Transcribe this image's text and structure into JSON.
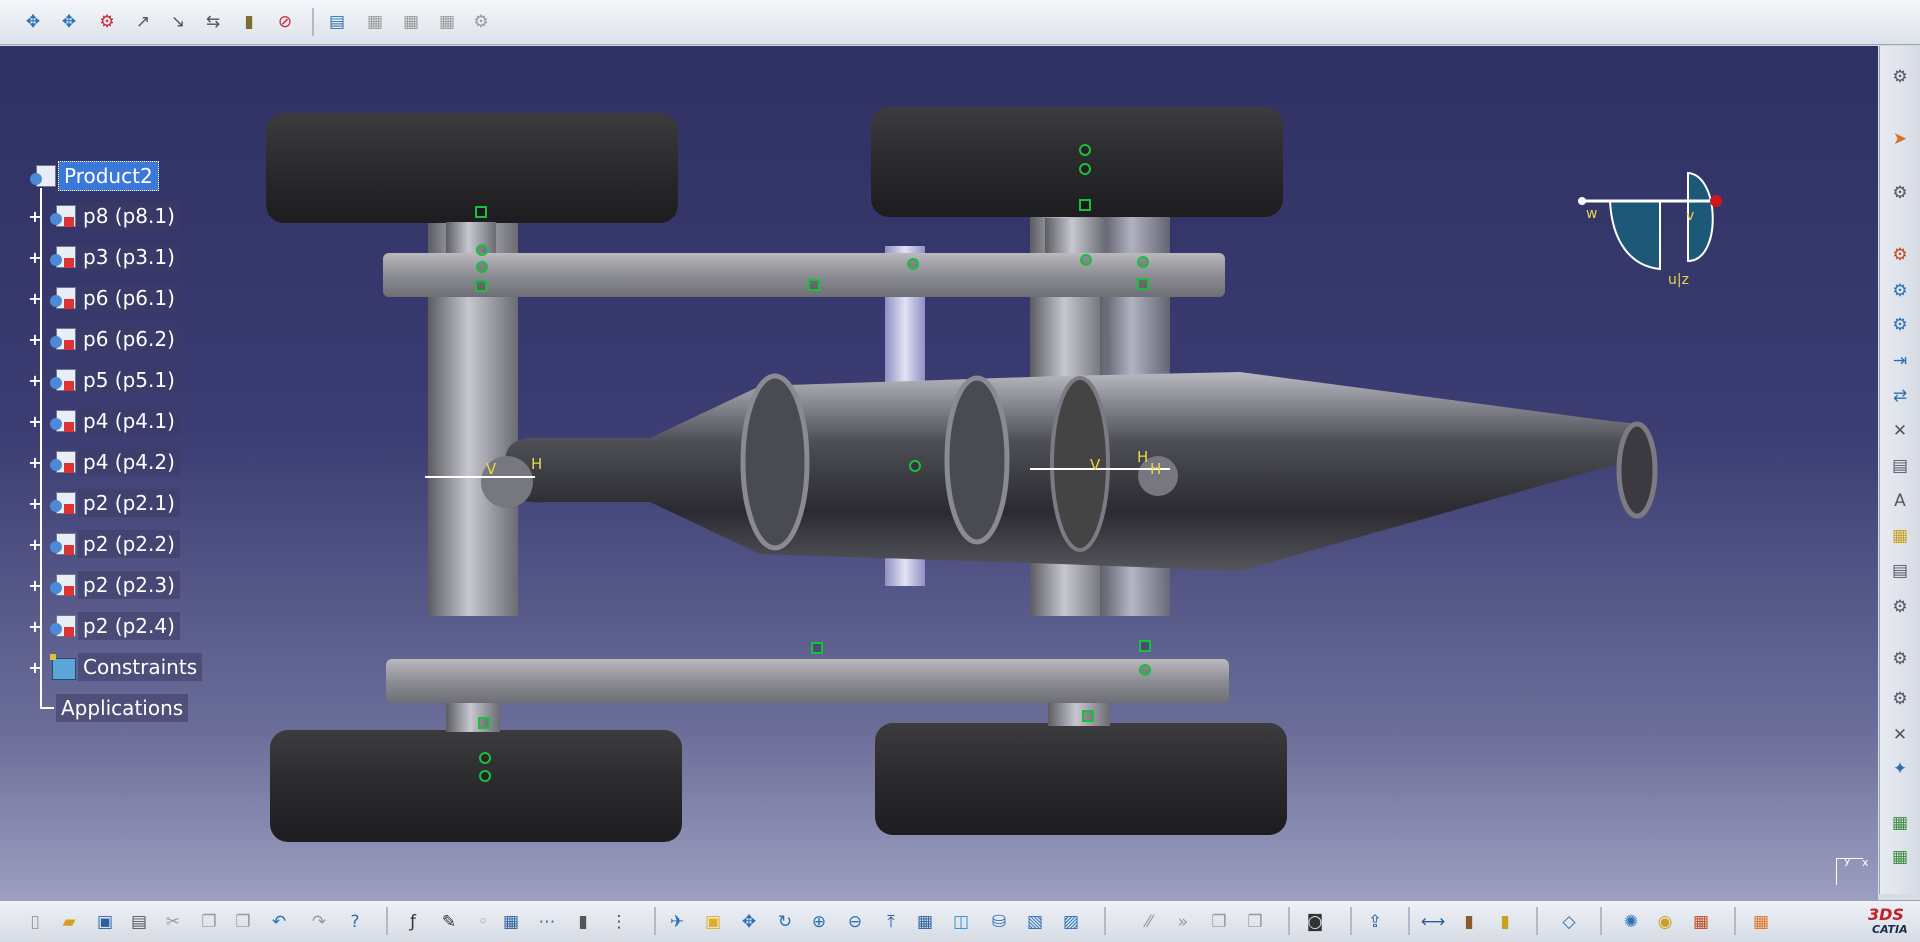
{
  "top_toolbar": {
    "icons": [
      "pan-icon",
      "rotate-icon",
      "snap-icon",
      "manipulate-icon",
      "explode-icon",
      "stop-manipulate-icon",
      "clash-icon",
      "edit-icon",
      "catalog-icon",
      "scene-icon",
      "reset-scene-icon",
      "enhanced-scene-icon"
    ]
  },
  "tree": {
    "root": "Product2",
    "items": [
      {
        "label": "p8 (p8.1)"
      },
      {
        "label": "p3 (p3.1)"
      },
      {
        "label": "p6 (p6.1)"
      },
      {
        "label": "p6 (p6.2)"
      },
      {
        "label": "p5 (p5.1)"
      },
      {
        "label": "p4 (p4.1)"
      },
      {
        "label": "p4 (p4.2)"
      },
      {
        "label": "p2 (p2.1)"
      },
      {
        "label": "p2 (p2.2)"
      },
      {
        "label": "p2 (p2.3)"
      },
      {
        "label": "p2 (p2.4)"
      }
    ],
    "constraints": "Constraints",
    "applications": "Applications"
  },
  "compass": {
    "w": "w",
    "v": "v",
    "uz": "u|z"
  },
  "constraint_labels": {
    "v": "V",
    "h": "H"
  },
  "axis_labels": {
    "y": "y",
    "x": "x"
  },
  "logo": {
    "brand": "CATIA",
    "mark": "3DS"
  },
  "colors": {
    "viewport_top": "#2f3163",
    "viewport_bottom": "#9c9fc0",
    "selection": "#3c78d8",
    "marker": "#18c040"
  }
}
